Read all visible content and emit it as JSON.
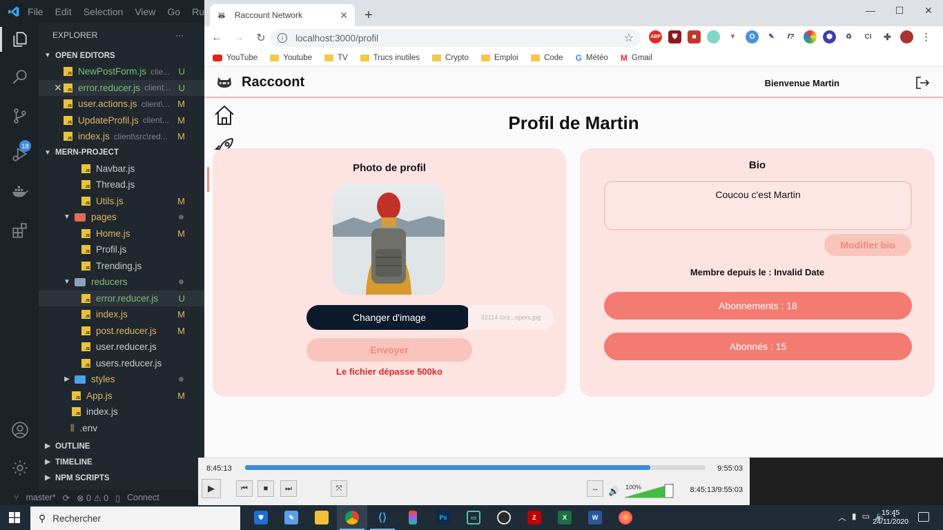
{
  "vscode": {
    "menu": [
      "File",
      "Edit",
      "Selection",
      "View",
      "Go",
      "Ru"
    ],
    "explorer_title": "EXPLORER",
    "explorer_more": "···",
    "open_editors_title": "OPEN EDITORS",
    "open_editors": [
      {
        "name": "NewPostForm.js",
        "path": "clie...",
        "status": "U"
      },
      {
        "name": "error.reducer.js",
        "path": "client...",
        "status": "U"
      },
      {
        "name": "user.actions.js",
        "path": "client\\...",
        "status": "M"
      },
      {
        "name": "UpdateProfil.js",
        "path": "client...",
        "status": "M"
      },
      {
        "name": "index.js",
        "path": "client\\src\\red...",
        "status": "M"
      }
    ],
    "close_mark": "✕",
    "project_title": "MERN-PROJECT",
    "tree": [
      {
        "name": "Navbar.js",
        "status": ""
      },
      {
        "name": "Thread.js",
        "status": ""
      },
      {
        "name": "Utils.js",
        "status": "M"
      },
      {
        "name": "pages",
        "status": ""
      },
      {
        "name": "Home.js",
        "status": "M"
      },
      {
        "name": "Profil.js",
        "status": ""
      },
      {
        "name": "Trending.js",
        "status": ""
      },
      {
        "name": "reducers",
        "status": ""
      },
      {
        "name": "error.reducer.js",
        "status": "U"
      },
      {
        "name": "index.js",
        "status": "M"
      },
      {
        "name": "post.reducer.js",
        "status": "M"
      },
      {
        "name": "user.reducer.js",
        "status": ""
      },
      {
        "name": "users.reducer.js",
        "status": ""
      },
      {
        "name": "styles",
        "status": ""
      },
      {
        "name": "App.js",
        "status": "M"
      },
      {
        "name": "index.js",
        "status": ""
      },
      {
        "name": ".env",
        "status": ""
      }
    ],
    "outline_title": "OUTLINE",
    "timeline_title": "TIMELINE",
    "npm_title": "NPM SCRIPTS",
    "badge": "18",
    "status_branch": "master*",
    "status_errors": "⊗ 0 ⚠ 0",
    "status_connect": "Connect"
  },
  "browser": {
    "tab_title": "Raccount Network",
    "tab_close": "✕",
    "new_tab": "+",
    "url": "localhost:3000/profil",
    "bookmarks": [
      "YouTube",
      "Youtube",
      "TV",
      "Trucs inutiles",
      "Crypto",
      "Emploi",
      "Code",
      "Météo",
      "Gmail"
    ]
  },
  "app": {
    "logo": "Raccoont",
    "welcome": "Bienvenue Martin",
    "page_title": "Profil de Martin",
    "photo_title": "Photo de profil",
    "change_image": "Changer d'image",
    "file_name": "92114-lors...opers.jpg",
    "send": "Envoyer",
    "error": "Le fichier dépasse 500ko",
    "bio_title": "Bio",
    "bio_text": "Coucou c'est Martin",
    "edit_bio": "Modifier bio",
    "member_since": "Membre depuis le : Invalid Date",
    "following": "Abonnements : 18",
    "followers": "Abonnés : 15"
  },
  "player": {
    "time_current": "8:45:13",
    "time_total": "9:55:03",
    "progress": 0.88,
    "volume_label": "100%",
    "volume": 1.0,
    "time_combo": "8:45:13/9:55:03"
  },
  "taskbar": {
    "search_placeholder": "Rechercher",
    "time": "15:45",
    "date": "24/11/2020"
  },
  "colors": {
    "accent_coral": "#f47b72",
    "soft_pink": "#fde4e1",
    "dark_button": "#0c1a2b",
    "error_red": "#d62828",
    "seek_blue": "#3f8ad8"
  }
}
